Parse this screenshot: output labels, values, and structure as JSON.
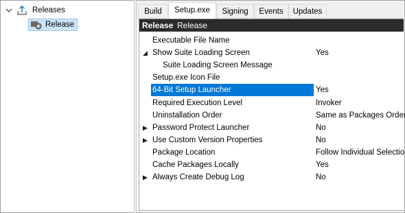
{
  "tree": {
    "root_label": "Releases",
    "child_label": "Release"
  },
  "tabs": [
    "Build",
    "Setup.exe",
    "Signing",
    "Events",
    "Updates"
  ],
  "active_tab": "Setup.exe",
  "grid_header": {
    "title": "Release",
    "subtitle": "Release"
  },
  "properties": [
    {
      "name": "Executable File Name",
      "value": "",
      "expander": "",
      "indent": false,
      "selected": false
    },
    {
      "name": "Show Suite Loading Screen",
      "value": "Yes",
      "expander": "expanded",
      "indent": false,
      "selected": false
    },
    {
      "name": "Suite Loading Screen Message",
      "value": "",
      "expander": "",
      "indent": true,
      "selected": false
    },
    {
      "name": "Setup.exe Icon File",
      "value": "",
      "expander": "",
      "indent": false,
      "selected": false
    },
    {
      "name": "64-Bit Setup Launcher",
      "value": "Yes",
      "expander": "",
      "indent": false,
      "selected": true
    },
    {
      "name": "Required Execution Level",
      "value": "Invoker",
      "expander": "",
      "indent": false,
      "selected": false
    },
    {
      "name": "Uninstallation Order",
      "value": "Same as Packages Order",
      "expander": "",
      "indent": false,
      "selected": false
    },
    {
      "name": "Password Protect Launcher",
      "value": "No",
      "expander": "collapsed",
      "indent": false,
      "selected": false
    },
    {
      "name": "Use Custom Version Properties",
      "value": "No",
      "expander": "collapsed",
      "indent": false,
      "selected": false
    },
    {
      "name": "Package Location",
      "value": "Follow Individual Selection",
      "expander": "",
      "indent": false,
      "selected": false
    },
    {
      "name": "Cache Packages Locally",
      "value": "Yes",
      "expander": "",
      "indent": false,
      "selected": false
    },
    {
      "name": "Always Create Debug Log",
      "value": "No",
      "expander": "collapsed",
      "indent": false,
      "selected": false
    }
  ],
  "colors": {
    "selection": "#0078d7",
    "header_bg": "#2b2b2b",
    "tree_selection": "#cce4f7"
  }
}
